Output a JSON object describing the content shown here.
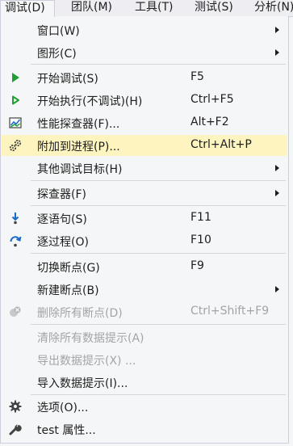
{
  "menubar": {
    "items": [
      {
        "label": "调试(D)"
      },
      {
        "label": "团队(M)"
      },
      {
        "label": "工具(T)"
      },
      {
        "label": "测试(S)"
      },
      {
        "label": "分析(N)"
      }
    ]
  },
  "menu": {
    "items": [
      {
        "label": "窗口(W)",
        "shortcut": ""
      },
      {
        "label": "图形(C)",
        "shortcut": ""
      },
      {
        "label": "开始调试(S)",
        "shortcut": "F5"
      },
      {
        "label": "开始执行(不调试)(H)",
        "shortcut": "Ctrl+F5"
      },
      {
        "label": "性能探查器(F)...",
        "shortcut": "Alt+F2"
      },
      {
        "label": "附加到进程(P)...",
        "shortcut": "Ctrl+Alt+P"
      },
      {
        "label": "其他调试目标(H)",
        "shortcut": ""
      },
      {
        "label": "探查器(F)",
        "shortcut": ""
      },
      {
        "label": "逐语句(S)",
        "shortcut": "F11"
      },
      {
        "label": "逐过程(O)",
        "shortcut": "F10"
      },
      {
        "label": "切换断点(G)",
        "shortcut": "F9"
      },
      {
        "label": "新建断点(B)",
        "shortcut": ""
      },
      {
        "label": "删除所有断点(D)",
        "shortcut": "Ctrl+Shift+F9"
      },
      {
        "label": "清除所有数据提示(A)",
        "shortcut": ""
      },
      {
        "label": "导出数据提示(X) ...",
        "shortcut": ""
      },
      {
        "label": "导入数据提示(I)...",
        "shortcut": ""
      },
      {
        "label": "选项(O)...",
        "shortcut": ""
      },
      {
        "label": "test 属性...",
        "shortcut": ""
      }
    ]
  },
  "colors": {
    "highlight": "#fdf4bf",
    "disabled_text": "#a2a4a5",
    "play_green": "#1e9e33",
    "step_blue": "#1b6ac9"
  },
  "icons": [
    "play-icon",
    "play-outline-icon",
    "performance-icon",
    "attach-process-icon",
    "step-into-icon",
    "step-over-icon",
    "delete-breakpoints-icon",
    "gear-icon",
    "wrench-icon"
  ]
}
